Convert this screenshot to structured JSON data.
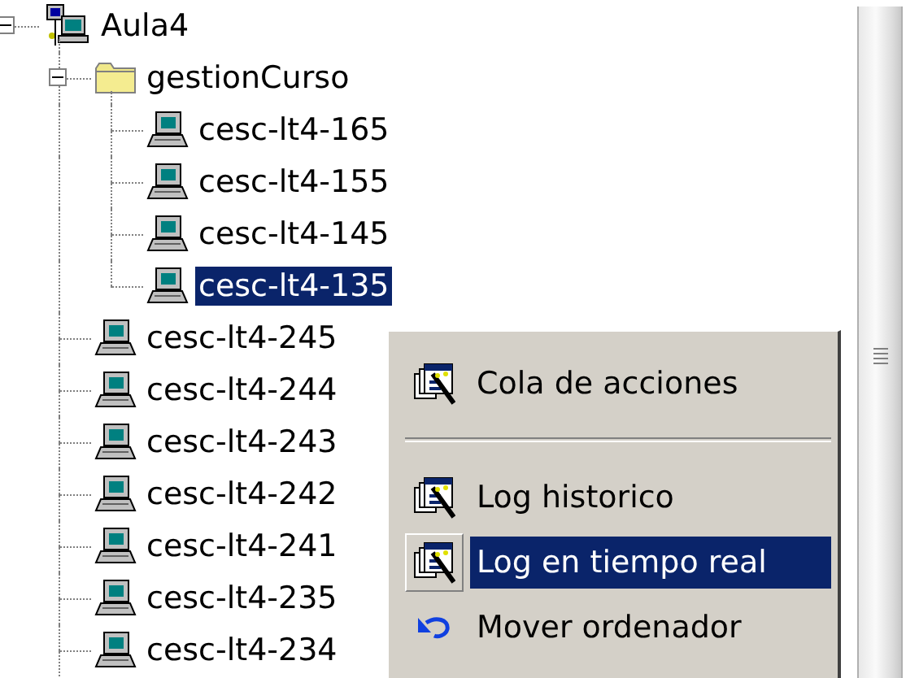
{
  "tree": [
    {
      "label": "Aula4",
      "kind": "group",
      "expanded": true,
      "selected": false,
      "children": [
        {
          "label": "gestionCurso",
          "kind": "folder",
          "expanded": true,
          "selected": false,
          "children": [
            {
              "label": "cesc-lt4-165",
              "kind": "computer",
              "selected": false
            },
            {
              "label": "cesc-lt4-155",
              "kind": "computer",
              "selected": false
            },
            {
              "label": "cesc-lt4-145",
              "kind": "computer",
              "selected": false
            },
            {
              "label": "cesc-lt4-135",
              "kind": "computer",
              "selected": true
            }
          ]
        },
        {
          "label": "cesc-lt4-245",
          "kind": "computer",
          "selected": false
        },
        {
          "label": "cesc-lt4-244",
          "kind": "computer",
          "selected": false
        },
        {
          "label": "cesc-lt4-243",
          "kind": "computer",
          "selected": false
        },
        {
          "label": "cesc-lt4-242",
          "kind": "computer",
          "selected": false
        },
        {
          "label": "cesc-lt4-241",
          "kind": "computer",
          "selected": false
        },
        {
          "label": "cesc-lt4-235",
          "kind": "computer",
          "selected": false
        },
        {
          "label": "cesc-lt4-234",
          "kind": "computer",
          "selected": false
        }
      ]
    }
  ],
  "context_menu": [
    {
      "kind": "action",
      "label": "Cola de acciones",
      "selected": false
    },
    {
      "kind": "separator"
    },
    {
      "kind": "action",
      "label": "Log historico",
      "selected": false
    },
    {
      "kind": "action",
      "label": "Log en tiempo real",
      "selected": true
    },
    {
      "kind": "move",
      "label": "Mover ordenador",
      "selected": false
    }
  ]
}
